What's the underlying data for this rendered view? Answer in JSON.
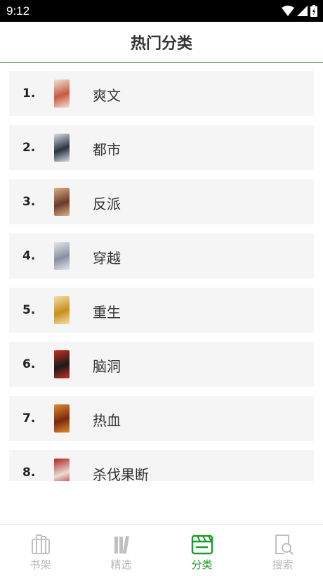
{
  "status_bar": {
    "time": "9:12"
  },
  "header": {
    "title": "热门分类"
  },
  "categories": [
    {
      "rank": "1.",
      "name": "爽文",
      "colors": [
        "#c85a40",
        "#f0e0d8"
      ]
    },
    {
      "rank": "2.",
      "name": "都市",
      "colors": [
        "#2a3340",
        "#d8dde4"
      ]
    },
    {
      "rank": "3.",
      "name": "反派",
      "colors": [
        "#6a3a2a",
        "#d9b08a"
      ]
    },
    {
      "rank": "4.",
      "name": "穿越",
      "colors": [
        "#8890a0",
        "#e8e8ee"
      ]
    },
    {
      "rank": "5.",
      "name": "重生",
      "colors": [
        "#c8901a",
        "#f2dfb0"
      ]
    },
    {
      "rank": "6.",
      "name": "脑洞",
      "colors": [
        "#1a1a1a",
        "#c83020"
      ]
    },
    {
      "rank": "7.",
      "name": "热血",
      "colors": [
        "#7a2a10",
        "#e08a30"
      ]
    },
    {
      "rank": "8.",
      "name": "杀伐果断",
      "colors": [
        "#e8dcd4",
        "#b02020"
      ]
    }
  ],
  "nav": [
    {
      "label": "书架",
      "icon": "bookshelf-icon"
    },
    {
      "label": "精选",
      "icon": "books-icon"
    },
    {
      "label": "分类",
      "icon": "clapper-icon"
    },
    {
      "label": "搜索",
      "icon": "search-book-icon"
    }
  ],
  "accent_color": "#1a9a2a"
}
